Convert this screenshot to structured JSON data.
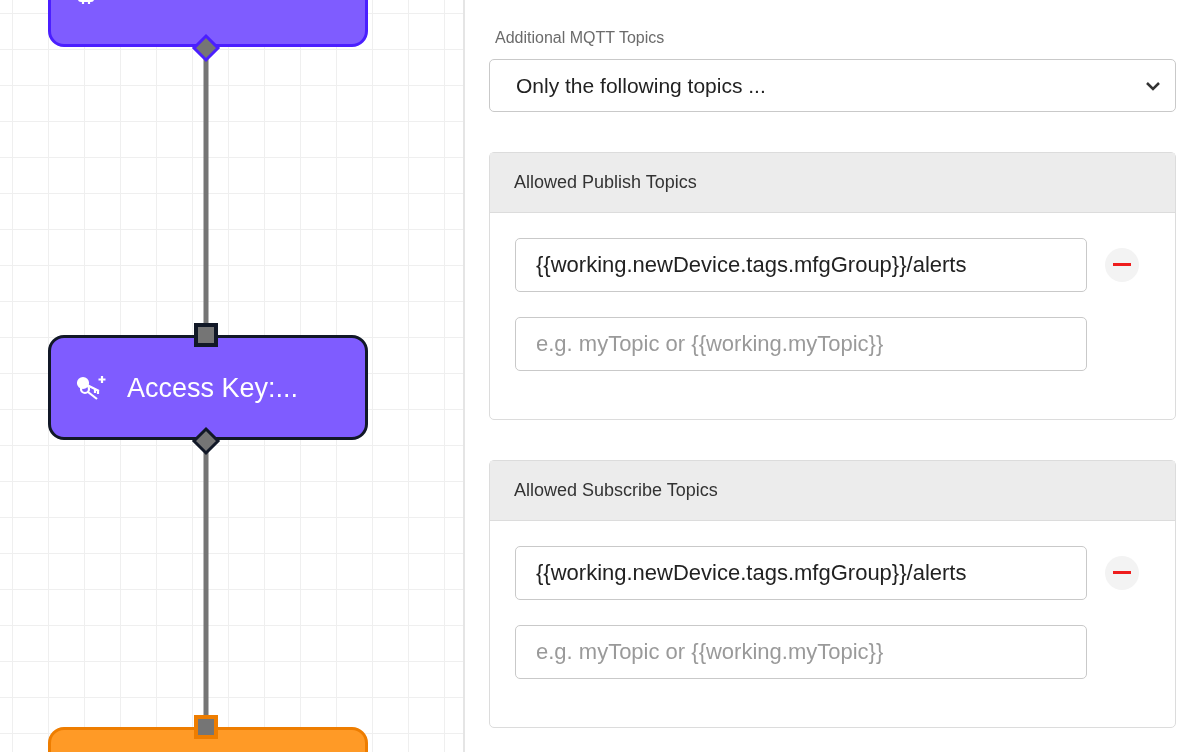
{
  "canvas": {
    "nodes": [
      {
        "kind": "chip",
        "color": "#7f5cff",
        "selected": false
      },
      {
        "label": "Access Key:...",
        "kind": "keys",
        "color": "#7f5cff",
        "selected": true
      },
      {
        "kind": "blank",
        "color": "#ff9a26",
        "selected": false
      }
    ]
  },
  "panel": {
    "select_label": "Additional MQTT Topics",
    "select_value": "Only the following topics ...",
    "sections": [
      {
        "title": "Allowed Publish Topics",
        "topics": [
          "{{working.newDevice.tags.mfgGroup}}/alerts"
        ],
        "placeholder": "e.g. myTopic or {{working.myTopic}}"
      },
      {
        "title": "Allowed Subscribe Topics",
        "topics": [
          "{{working.newDevice.tags.mfgGroup}}/alerts"
        ],
        "placeholder": "e.g. myTopic or {{working.myTopic}}"
      }
    ]
  }
}
